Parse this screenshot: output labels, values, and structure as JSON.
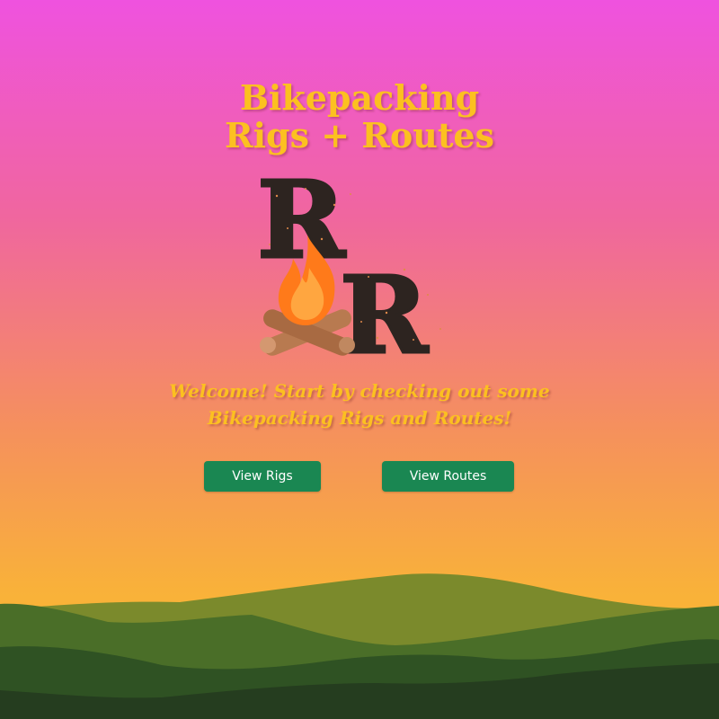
{
  "title": {
    "line1": "Bikepacking",
    "line2": "Rigs + Routes"
  },
  "logo": {
    "letters": [
      "R",
      "R"
    ],
    "icon": "campfire-icon",
    "letter_color": "#2d2420",
    "flame_colors": [
      "#ff7a1a",
      "#ffa640"
    ],
    "log_color": "#b87a50"
  },
  "welcome": {
    "line1": "Welcome! Start by checking out some",
    "line2": "Bikepacking Rigs and Routes!"
  },
  "buttons": {
    "rigs_label": "View Rigs",
    "routes_label": "View Routes"
  },
  "colors": {
    "title": "#fcc020",
    "button": "#1a8752",
    "sky_top": "#ef52df",
    "sky_bottom": "#fbbd2c",
    "mountain_far": "#7b8a2c",
    "mountain_mid": "#4a6e28",
    "mountain_near": "#2f5223",
    "mountain_front": "#253d1f"
  }
}
